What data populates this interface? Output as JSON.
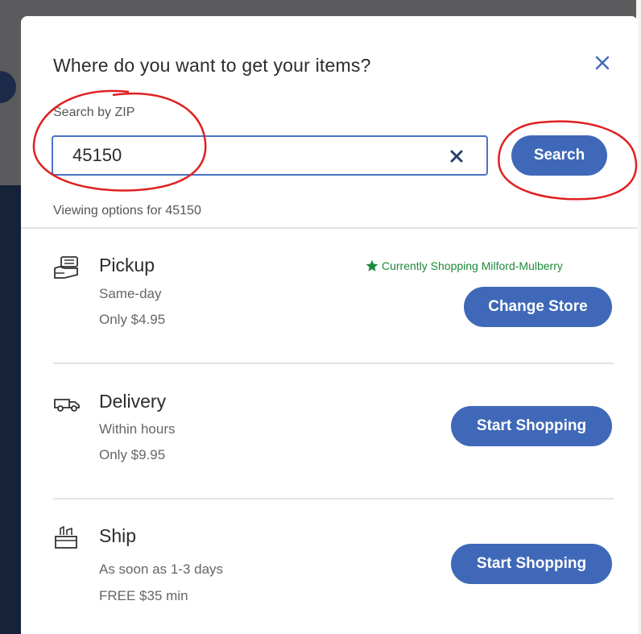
{
  "modal": {
    "title": "Where do you want to get your items?",
    "close_icon": "close-icon"
  },
  "zip": {
    "label": "Search by ZIP",
    "value": "45150",
    "clear_icon": "clear-icon",
    "search_label": "Search",
    "viewing_text": "Viewing options for 45150"
  },
  "options": {
    "pickup": {
      "icon": "pickup-icon",
      "title": "Pickup",
      "line1": "Same-day",
      "line2": "Only $4.95",
      "status": "Currently Shopping Milford-Mulberry",
      "status_icon": "star-icon",
      "button": "Change Store"
    },
    "delivery": {
      "icon": "delivery-truck-icon",
      "title": "Delivery",
      "line1": "Within hours",
      "line2": "Only $9.95",
      "button": "Start Shopping"
    },
    "ship": {
      "icon": "ship-box-icon",
      "title": "Ship",
      "line1": "As soon as 1-3 days",
      "line2": "FREE $35 min",
      "button": "Start Shopping"
    }
  },
  "colors": {
    "accent": "#3f69b8",
    "status_green": "#1b8a3a",
    "annotation_red": "#e02020"
  }
}
